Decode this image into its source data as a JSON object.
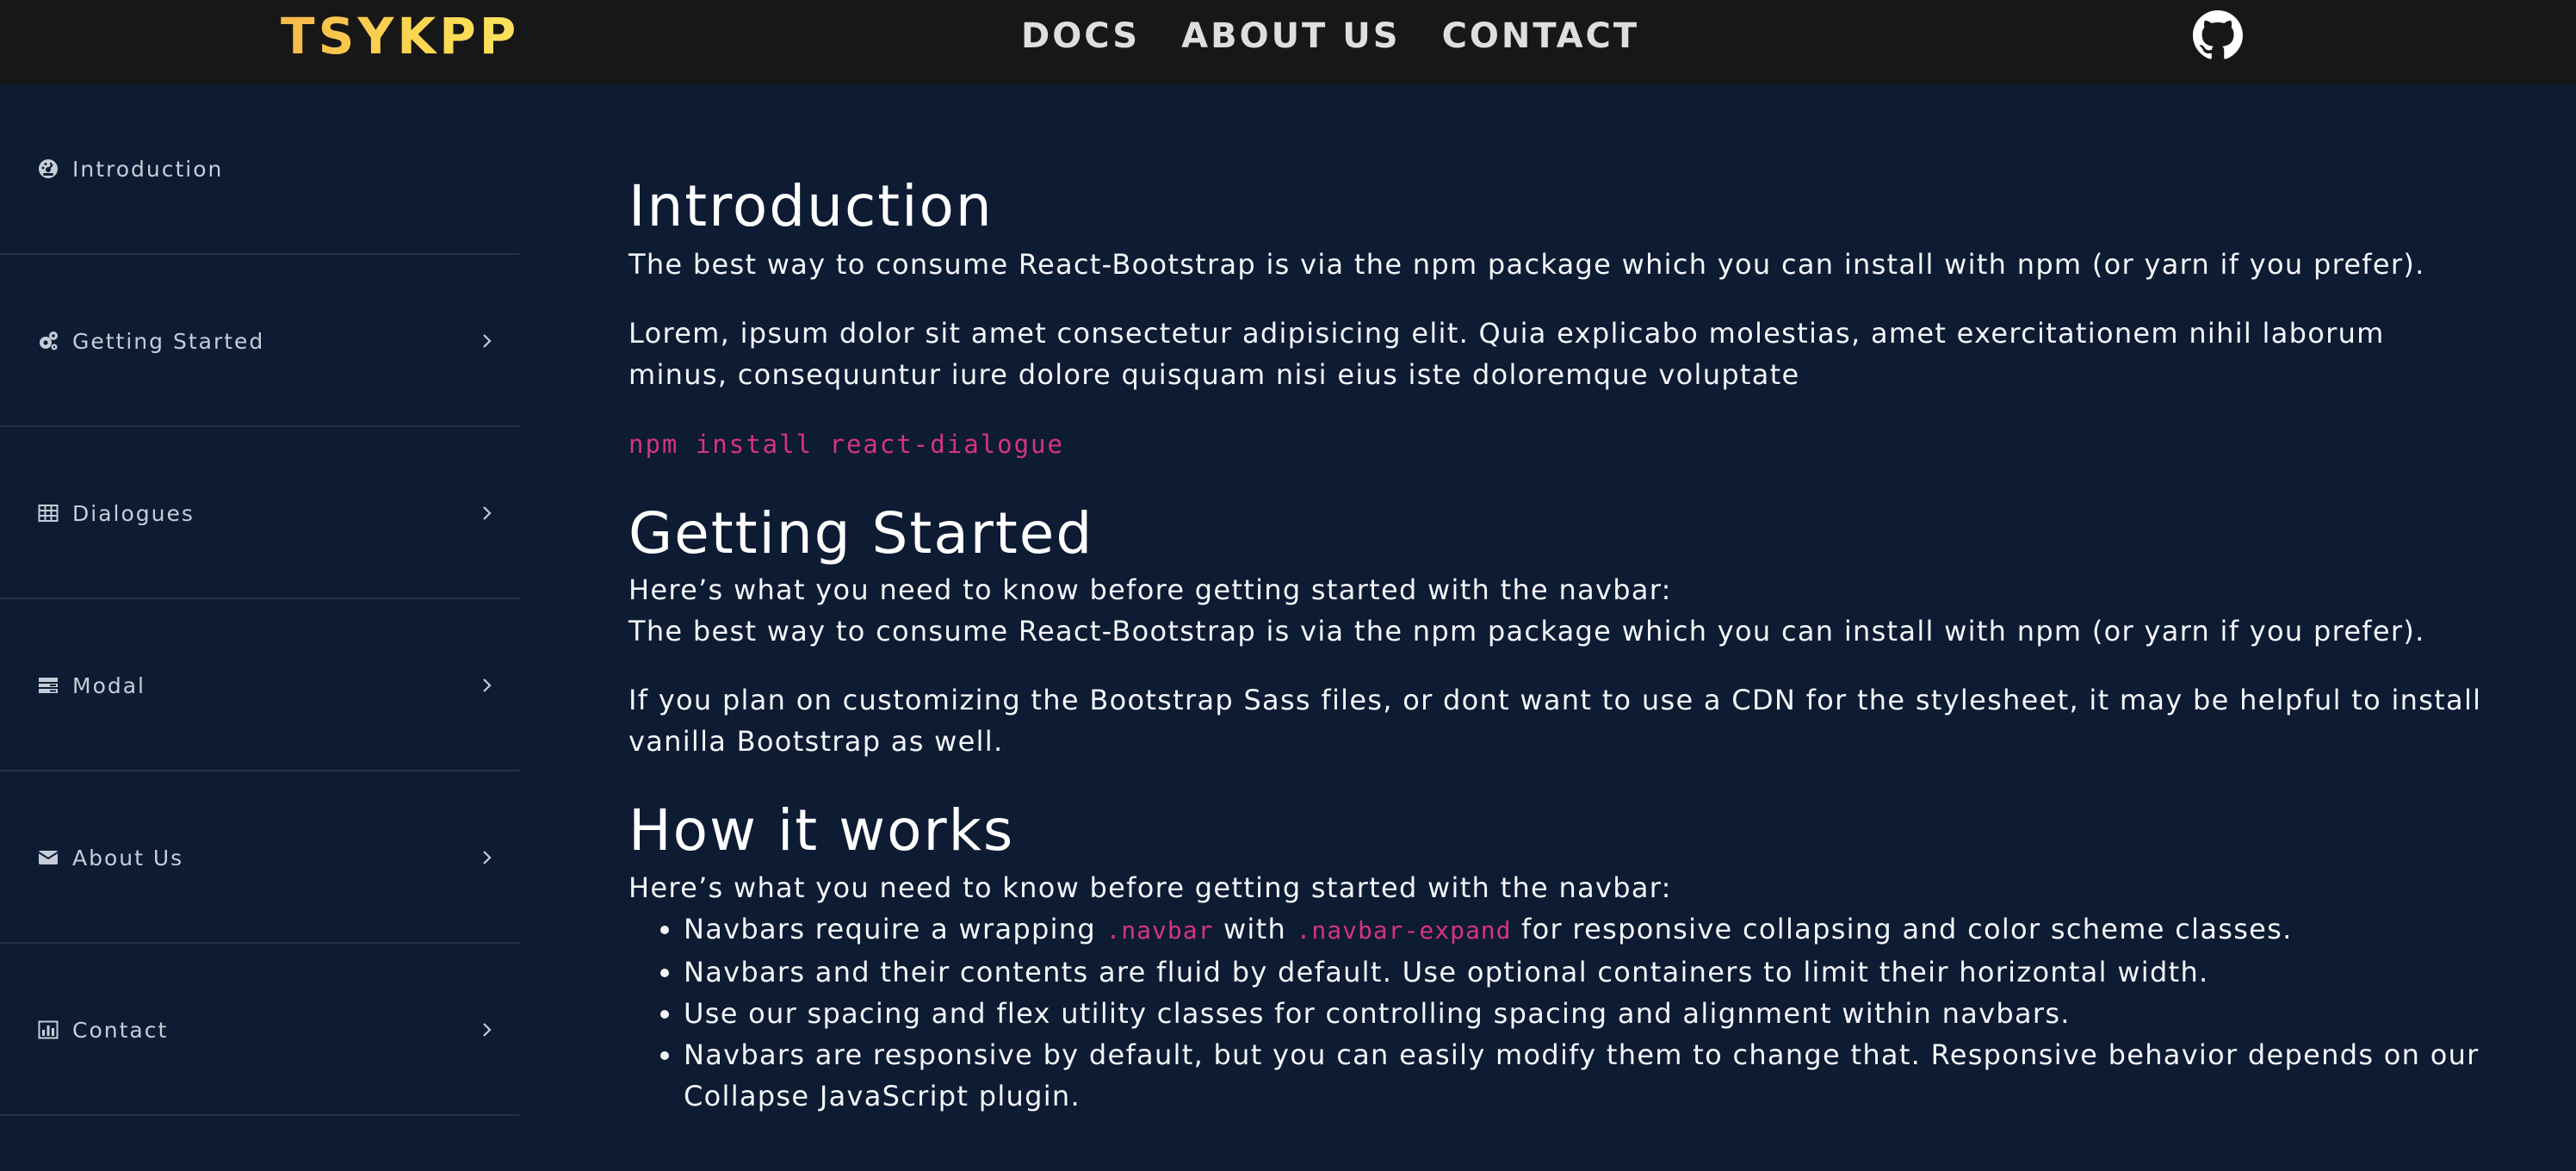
{
  "navbar": {
    "brand": "TSYKPP",
    "links": [
      "DOCS",
      "ABOUT US",
      "CONTACT"
    ],
    "github_icon": "github-icon",
    "brand_gradient": [
      "#f8b94a",
      "#fde25c"
    ],
    "background": "#171717"
  },
  "sidebar": {
    "items": [
      {
        "label": "Introduction",
        "icon": "dashboard-gauge-icon",
        "has_chevron": false
      },
      {
        "label": "Getting Started",
        "icon": "gears-icon",
        "has_chevron": true
      },
      {
        "label": "Dialogues",
        "icon": "table-icon",
        "has_chevron": true
      },
      {
        "label": "Modal",
        "icon": "list-icon",
        "has_chevron": true
      },
      {
        "label": "About Us",
        "icon": "envelope-icon",
        "has_chevron": true
      },
      {
        "label": "Contact",
        "icon": "bar-chart-icon",
        "has_chevron": true
      }
    ]
  },
  "content": {
    "intro": {
      "heading": "Introduction",
      "p1": "The best way to consume React-Bootstrap is via the npm package which you can install with npm (or yarn if you prefer).",
      "p2": "Lorem, ipsum dolor sit amet consectetur adipisicing elit. Quia explicabo molestias, amet exercitationem nihil laborum minus, consequuntur iure dolore quisquam nisi eius iste doloremque voluptate",
      "code": "npm install react-dialogue"
    },
    "getting_started": {
      "heading": "Getting Started",
      "line1": "Here’s what you need to know before getting started with the navbar:",
      "line2": "The best way to consume React-Bootstrap is via the npm package which you can install with npm (or yarn if you prefer).",
      "p3": "If you plan on customizing the Bootstrap Sass files, or dont want to use a CDN for the stylesheet, it may be helpful to install vanilla Bootstrap as well."
    },
    "how_it_works": {
      "heading": "How it works",
      "intro": "Here’s what you need to know before getting started with the navbar:",
      "bullet1": {
        "pre": "Navbars require a wrapping ",
        "code1": ".navbar",
        "mid": " with ",
        "code2": ".navbar-expand",
        "post": " for responsive collapsing and color scheme classes."
      },
      "bullet2": "Navbars and their contents are fluid by default. Use optional containers to limit their horizontal width.",
      "bullet3": "Use our spacing and flex utility classes for controlling spacing and alignment within navbars.",
      "bullet4": "Navbars are responsive by default, but you can easily modify them to change that. Responsive behavior depends on our Collapse JavaScript plugin."
    }
  },
  "colors": {
    "page_background": "#0d1b33",
    "code_accent": "#d63384",
    "sidebar_divider": "#24324a"
  }
}
